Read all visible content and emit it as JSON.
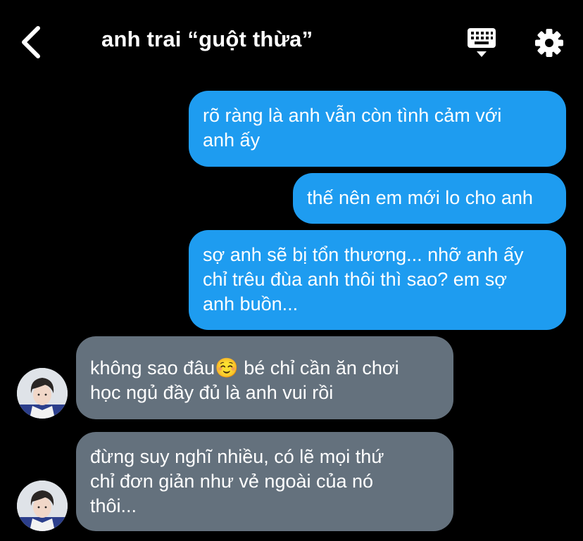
{
  "header": {
    "title": "anh trai “guột thừa”",
    "back_icon": "chevron-left-icon",
    "keyboard_icon": "keyboard-icon",
    "settings_icon": "gear-icon"
  },
  "messages": [
    {
      "direction": "outgoing",
      "lines": [
        "rõ ràng là anh vẫn còn tình cảm với",
        "anh ấy"
      ]
    },
    {
      "direction": "outgoing",
      "lines": [
        "thế nên em mới lo cho anh"
      ]
    },
    {
      "direction": "outgoing",
      "lines": [
        "sợ anh sẽ bị tổn thương... nhỡ anh ấy",
        "chỉ trêu đùa anh thôi thì sao? em sợ",
        "anh buồn..."
      ]
    },
    {
      "direction": "incoming",
      "lines": [
        "không sao đâu☺️ bé chỉ cần ăn chơi",
        "học ngủ đầy đủ là anh vui rồi"
      ]
    },
    {
      "direction": "incoming",
      "lines": [
        "đừng suy nghĩ nhiều, có lẽ mọi thứ",
        "chỉ đơn giản như vẻ ngoài của nó",
        "thôi..."
      ]
    }
  ],
  "colors": {
    "background": "#000000",
    "outgoing_bubble": "#1e9cf0",
    "incoming_bubble": "#64717d",
    "text": "#ffffff"
  }
}
